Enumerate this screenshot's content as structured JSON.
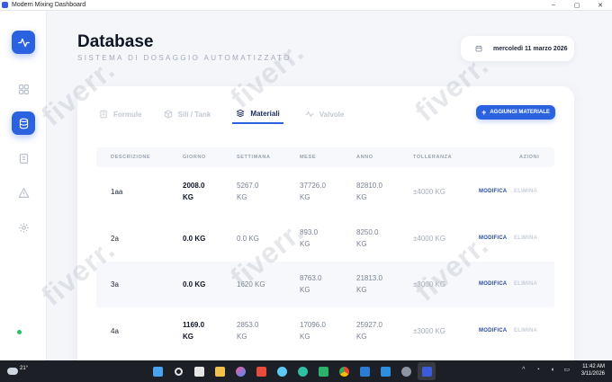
{
  "window": {
    "title": "Modern Mixing Dashboard",
    "controls": [
      "–",
      "▢",
      "✕"
    ]
  },
  "sidebar": {
    "items": [
      {
        "icon": "pulse-icon",
        "active": true
      },
      {
        "icon": "grid-icon",
        "active": false
      },
      {
        "icon": "database-icon",
        "active": true
      },
      {
        "icon": "report-icon",
        "active": false
      },
      {
        "icon": "warning-icon",
        "active": false
      },
      {
        "icon": "gear-icon",
        "active": false
      }
    ],
    "status_color": "#22c55e"
  },
  "header": {
    "title": "Database",
    "subtitle": "SISTEMA DI DOSAGGIO AUTOMATIZZATO",
    "date": "mercoledì 11 marzo 2026"
  },
  "tabs": [
    {
      "label": "Formule",
      "icon": "document-icon",
      "active": false
    },
    {
      "label": "Sili / Tank",
      "icon": "cube-icon",
      "active": false
    },
    {
      "label": "Materiali",
      "icon": "layers-icon",
      "active": true
    },
    {
      "label": "Valvole",
      "icon": "wave-icon",
      "active": false
    }
  ],
  "add_button": {
    "label": "AGGIUNGI MATERIALE"
  },
  "table": {
    "columns": [
      "DESCRIZIONE",
      "GIORNO",
      "SETTIMANA",
      "MESE",
      "ANNO",
      "TOLLERANZA",
      "AZIONI"
    ],
    "rows": [
      {
        "desc": "1aa",
        "giorno": [
          "2008.0",
          "KG"
        ],
        "settimana": [
          "5267.0",
          "KG"
        ],
        "mese": [
          "37726.0",
          "KG"
        ],
        "anno": [
          "82810.0",
          "KG"
        ],
        "tolleranza": "±4000 KG"
      },
      {
        "desc": "2a",
        "giorno": [
          "0.0 KG",
          ""
        ],
        "settimana": [
          "0.0 KG",
          ""
        ],
        "mese": [
          "893.0",
          "KG"
        ],
        "anno": [
          "8250.0",
          "KG"
        ],
        "tolleranza": "±4000 KG"
      },
      {
        "desc": "3a",
        "giorno": [
          "0.0 KG",
          ""
        ],
        "settimana": [
          "1620 KG",
          ""
        ],
        "mese": [
          "8763.0",
          "KG"
        ],
        "anno": [
          "21813.0",
          "KG"
        ],
        "tolleranza": "±3000 KG"
      },
      {
        "desc": "4a",
        "giorno": [
          "1169.0",
          "KG"
        ],
        "settimana": [
          "2853.0",
          "KG"
        ],
        "mese": [
          "17096.0",
          "KG"
        ],
        "anno": [
          "25927.0",
          "KG"
        ],
        "tolleranza": "±3000 KG"
      }
    ],
    "edit_label": "MODIFICA",
    "delete_label": "ELIMINA"
  },
  "watermark": "fiverr.",
  "taskbar": {
    "temperature": "21°",
    "time": "11:42 AM",
    "date": "3/11/2026"
  },
  "colors": {
    "accent": "#2a62e0",
    "title": "#0f1626",
    "muted": "#9aa3b1"
  }
}
